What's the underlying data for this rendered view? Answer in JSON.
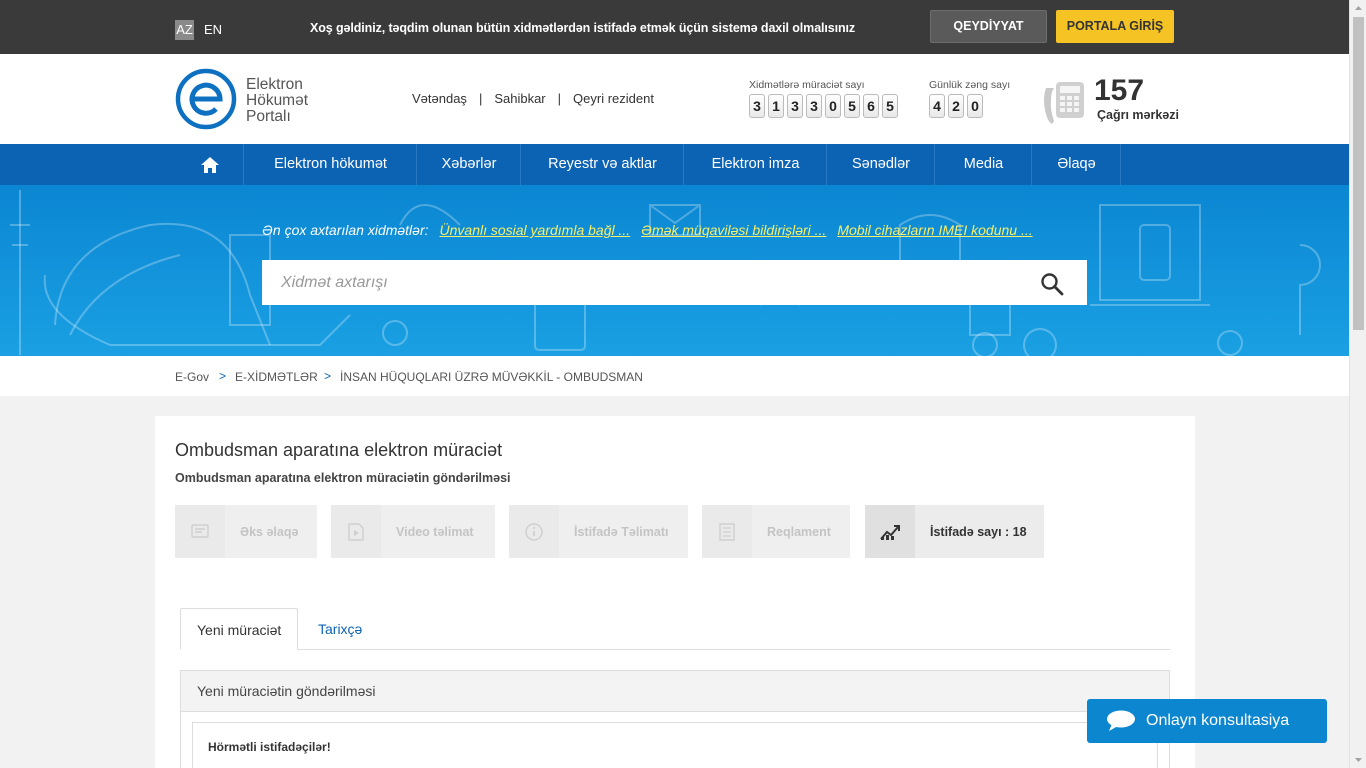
{
  "topbar": {
    "lang_az": "AZ",
    "lang_en": "EN",
    "welcome": "Xoş gəldiniz, təqdim olunan bütün xidmətlərdən istifadə etmək üçün sistemə daxil olmalısınız",
    "register_label": "QEYDİYYAT",
    "login_label": "PORTALA GİRİŞ"
  },
  "header": {
    "logo_line1": "Elektron",
    "logo_line2": "Hökumət",
    "logo_line3": "Portalı",
    "audience": [
      "Vətəndaş",
      "Sahibkar",
      "Qeyri rezident"
    ],
    "audience_sep": "|",
    "requests_label": "Xidmətlərə müraciət sayı",
    "requests_digits": [
      "3",
      "1",
      "3",
      "3",
      "0",
      "5",
      "6",
      "5"
    ],
    "calls_label": "Günlük zəng sayı",
    "calls_digits": [
      "4",
      "2",
      "0"
    ],
    "callcenter_number": "157",
    "callcenter_label": "Çağrı mərkəzi"
  },
  "nav": {
    "items": [
      "Elektron hökumət",
      "Xəbərlər",
      "Reyestr və aktlar",
      "Elektron imza",
      "Sənədlər",
      "Media",
      "Əlaqə"
    ]
  },
  "hero": {
    "popular_label": "Ən çox axtarılan xidmətlər:",
    "popular_links": [
      "Ünvanlı sosial yardımla bağl ...",
      "Əmək müqaviləsi bildirişləri ...",
      "Mobil cihazların IMEI kodunu ..."
    ],
    "search_placeholder": "Xidmət axtarışı"
  },
  "breadcrumb": {
    "items": [
      "E-Gov",
      "E-XİDMƏTLƏR",
      "İNSAN HÜQUQLARI ÜZRƏ MÜVƏKKİL - OMBUDSMAN"
    ],
    "sep": ">"
  },
  "service": {
    "title": "Ombudsman aparatına elektron müraciət",
    "subtitle": "Ombudsman aparatına elektron müraciətin göndərilməsi",
    "actions": [
      "Əks əlaqə",
      "Video təlimat",
      "İstifadə Təlimatı",
      "Reqlament",
      "İstifadə sayı : 18"
    ]
  },
  "tabs": [
    "Yeni müraciət",
    "Tarixçə"
  ],
  "form": {
    "heading": "Yeni müraciətin göndərilməsi",
    "notice_title": "Hörmətli istifadəçilər!"
  },
  "chat": {
    "label": "Onlayn konsultasiya"
  },
  "colors": {
    "brand_blue": "#0d63b3",
    "accent_yellow": "#f6c324",
    "topbar": "#3a3a3a",
    "hero": "#1aa0e3",
    "link_yellow": "#f8ef6a"
  }
}
